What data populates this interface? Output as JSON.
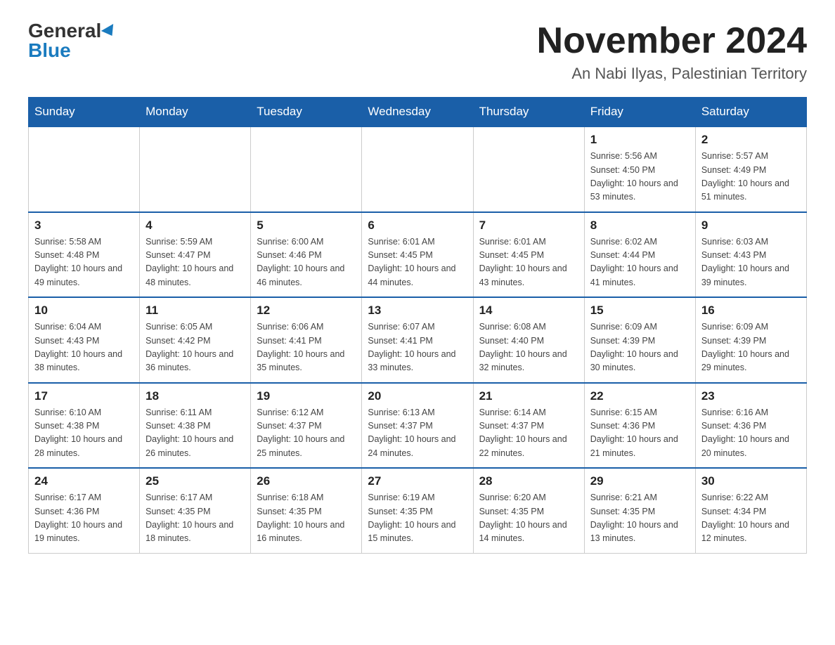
{
  "logo": {
    "general": "General",
    "blue": "Blue"
  },
  "header": {
    "month_title": "November 2024",
    "subtitle": "An Nabi Ilyas, Palestinian Territory"
  },
  "days": [
    "Sunday",
    "Monday",
    "Tuesday",
    "Wednesday",
    "Thursday",
    "Friday",
    "Saturday"
  ],
  "weeks": [
    [
      {
        "day": "",
        "sunrise": "",
        "sunset": "",
        "daylight": ""
      },
      {
        "day": "",
        "sunrise": "",
        "sunset": "",
        "daylight": ""
      },
      {
        "day": "",
        "sunrise": "",
        "sunset": "",
        "daylight": ""
      },
      {
        "day": "",
        "sunrise": "",
        "sunset": "",
        "daylight": ""
      },
      {
        "day": "",
        "sunrise": "",
        "sunset": "",
        "daylight": ""
      },
      {
        "day": "1",
        "sunrise": "Sunrise: 5:56 AM",
        "sunset": "Sunset: 4:50 PM",
        "daylight": "Daylight: 10 hours and 53 minutes."
      },
      {
        "day": "2",
        "sunrise": "Sunrise: 5:57 AM",
        "sunset": "Sunset: 4:49 PM",
        "daylight": "Daylight: 10 hours and 51 minutes."
      }
    ],
    [
      {
        "day": "3",
        "sunrise": "Sunrise: 5:58 AM",
        "sunset": "Sunset: 4:48 PM",
        "daylight": "Daylight: 10 hours and 49 minutes."
      },
      {
        "day": "4",
        "sunrise": "Sunrise: 5:59 AM",
        "sunset": "Sunset: 4:47 PM",
        "daylight": "Daylight: 10 hours and 48 minutes."
      },
      {
        "day": "5",
        "sunrise": "Sunrise: 6:00 AM",
        "sunset": "Sunset: 4:46 PM",
        "daylight": "Daylight: 10 hours and 46 minutes."
      },
      {
        "day": "6",
        "sunrise": "Sunrise: 6:01 AM",
        "sunset": "Sunset: 4:45 PM",
        "daylight": "Daylight: 10 hours and 44 minutes."
      },
      {
        "day": "7",
        "sunrise": "Sunrise: 6:01 AM",
        "sunset": "Sunset: 4:45 PM",
        "daylight": "Daylight: 10 hours and 43 minutes."
      },
      {
        "day": "8",
        "sunrise": "Sunrise: 6:02 AM",
        "sunset": "Sunset: 4:44 PM",
        "daylight": "Daylight: 10 hours and 41 minutes."
      },
      {
        "day": "9",
        "sunrise": "Sunrise: 6:03 AM",
        "sunset": "Sunset: 4:43 PM",
        "daylight": "Daylight: 10 hours and 39 minutes."
      }
    ],
    [
      {
        "day": "10",
        "sunrise": "Sunrise: 6:04 AM",
        "sunset": "Sunset: 4:43 PM",
        "daylight": "Daylight: 10 hours and 38 minutes."
      },
      {
        "day": "11",
        "sunrise": "Sunrise: 6:05 AM",
        "sunset": "Sunset: 4:42 PM",
        "daylight": "Daylight: 10 hours and 36 minutes."
      },
      {
        "day": "12",
        "sunrise": "Sunrise: 6:06 AM",
        "sunset": "Sunset: 4:41 PM",
        "daylight": "Daylight: 10 hours and 35 minutes."
      },
      {
        "day": "13",
        "sunrise": "Sunrise: 6:07 AM",
        "sunset": "Sunset: 4:41 PM",
        "daylight": "Daylight: 10 hours and 33 minutes."
      },
      {
        "day": "14",
        "sunrise": "Sunrise: 6:08 AM",
        "sunset": "Sunset: 4:40 PM",
        "daylight": "Daylight: 10 hours and 32 minutes."
      },
      {
        "day": "15",
        "sunrise": "Sunrise: 6:09 AM",
        "sunset": "Sunset: 4:39 PM",
        "daylight": "Daylight: 10 hours and 30 minutes."
      },
      {
        "day": "16",
        "sunrise": "Sunrise: 6:09 AM",
        "sunset": "Sunset: 4:39 PM",
        "daylight": "Daylight: 10 hours and 29 minutes."
      }
    ],
    [
      {
        "day": "17",
        "sunrise": "Sunrise: 6:10 AM",
        "sunset": "Sunset: 4:38 PM",
        "daylight": "Daylight: 10 hours and 28 minutes."
      },
      {
        "day": "18",
        "sunrise": "Sunrise: 6:11 AM",
        "sunset": "Sunset: 4:38 PM",
        "daylight": "Daylight: 10 hours and 26 minutes."
      },
      {
        "day": "19",
        "sunrise": "Sunrise: 6:12 AM",
        "sunset": "Sunset: 4:37 PM",
        "daylight": "Daylight: 10 hours and 25 minutes."
      },
      {
        "day": "20",
        "sunrise": "Sunrise: 6:13 AM",
        "sunset": "Sunset: 4:37 PM",
        "daylight": "Daylight: 10 hours and 24 minutes."
      },
      {
        "day": "21",
        "sunrise": "Sunrise: 6:14 AM",
        "sunset": "Sunset: 4:37 PM",
        "daylight": "Daylight: 10 hours and 22 minutes."
      },
      {
        "day": "22",
        "sunrise": "Sunrise: 6:15 AM",
        "sunset": "Sunset: 4:36 PM",
        "daylight": "Daylight: 10 hours and 21 minutes."
      },
      {
        "day": "23",
        "sunrise": "Sunrise: 6:16 AM",
        "sunset": "Sunset: 4:36 PM",
        "daylight": "Daylight: 10 hours and 20 minutes."
      }
    ],
    [
      {
        "day": "24",
        "sunrise": "Sunrise: 6:17 AM",
        "sunset": "Sunset: 4:36 PM",
        "daylight": "Daylight: 10 hours and 19 minutes."
      },
      {
        "day": "25",
        "sunrise": "Sunrise: 6:17 AM",
        "sunset": "Sunset: 4:35 PM",
        "daylight": "Daylight: 10 hours and 18 minutes."
      },
      {
        "day": "26",
        "sunrise": "Sunrise: 6:18 AM",
        "sunset": "Sunset: 4:35 PM",
        "daylight": "Daylight: 10 hours and 16 minutes."
      },
      {
        "day": "27",
        "sunrise": "Sunrise: 6:19 AM",
        "sunset": "Sunset: 4:35 PM",
        "daylight": "Daylight: 10 hours and 15 minutes."
      },
      {
        "day": "28",
        "sunrise": "Sunrise: 6:20 AM",
        "sunset": "Sunset: 4:35 PM",
        "daylight": "Daylight: 10 hours and 14 minutes."
      },
      {
        "day": "29",
        "sunrise": "Sunrise: 6:21 AM",
        "sunset": "Sunset: 4:35 PM",
        "daylight": "Daylight: 10 hours and 13 minutes."
      },
      {
        "day": "30",
        "sunrise": "Sunrise: 6:22 AM",
        "sunset": "Sunset: 4:34 PM",
        "daylight": "Daylight: 10 hours and 12 minutes."
      }
    ]
  ]
}
